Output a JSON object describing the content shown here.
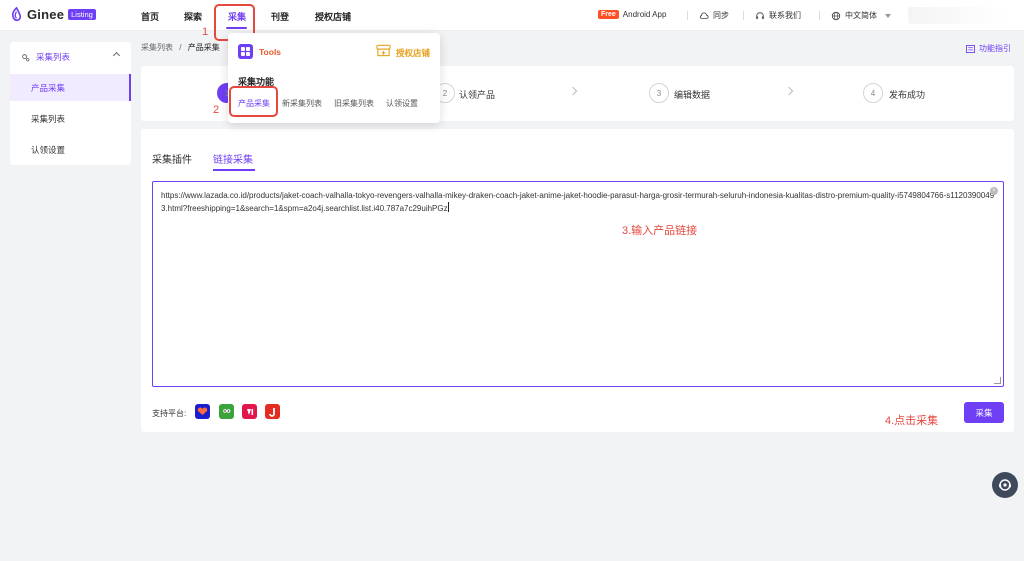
{
  "app": {
    "logo_text": "Ginee",
    "logo_badge": "Listing"
  },
  "nav": {
    "home": "首页",
    "explore": "探索",
    "collect": "采集",
    "listing": "刊登",
    "authorized_store": "授权店铺"
  },
  "header_right": {
    "free_badge": "Free",
    "android_app": "Android App",
    "sync": "同步",
    "contact": "联系我们",
    "language": "中文简体"
  },
  "annotations": {
    "a1": "1",
    "a2": "2",
    "a3": "3.输入产品链接",
    "a4": "4.点击采集"
  },
  "sidebar": {
    "header": "采集列表",
    "items": [
      "产品采集",
      "采集列表",
      "认领设置"
    ]
  },
  "breadcrumb": {
    "parent": "采集列表",
    "separator": "/",
    "current": "产品采集"
  },
  "function_guide": "功能指引",
  "steps": [
    {
      "num": "1",
      "label": ""
    },
    {
      "num": "2",
      "label": "认领产品"
    },
    {
      "num": "3",
      "label": "编辑数据"
    },
    {
      "num": "4",
      "label": "发布成功"
    }
  ],
  "popup": {
    "tools_label": "Tools",
    "store_label": "授权店铺",
    "section_title": "采集功能",
    "links": [
      "产品采集",
      "新采集列表",
      "旧采集列表",
      "认领设置"
    ]
  },
  "tabs": [
    "采集插件",
    "链接采集"
  ],
  "url_input": {
    "value": "https://www.lazada.co.id/products/jaket-coach-valhalla-tokyo-revengers-valhalla-mikey-draken-coach-jaket-anime-jaket-hoodie-parasut-harga-grosir-termurah-seluruh-indonesia-kualitas-distro-premium-quality-i5749804766-s11203900493.html?freeshipping=1&search=1&spm=a2o4j.searchlist.list.i40.787a7c29uihPGz"
  },
  "platforms": {
    "label": "支持平台:",
    "items": [
      {
        "name": "lazada",
        "color": "#1a1ecf"
      },
      {
        "name": "tokopedia",
        "color": "#3aa33a"
      },
      {
        "name": "bukalapak",
        "color": "#e3164c"
      },
      {
        "name": "jdid",
        "color": "#e42d20"
      }
    ]
  },
  "collect_button": "采集",
  "colors": {
    "primary": "#6f3ff5",
    "annotation": "#e5483f"
  }
}
